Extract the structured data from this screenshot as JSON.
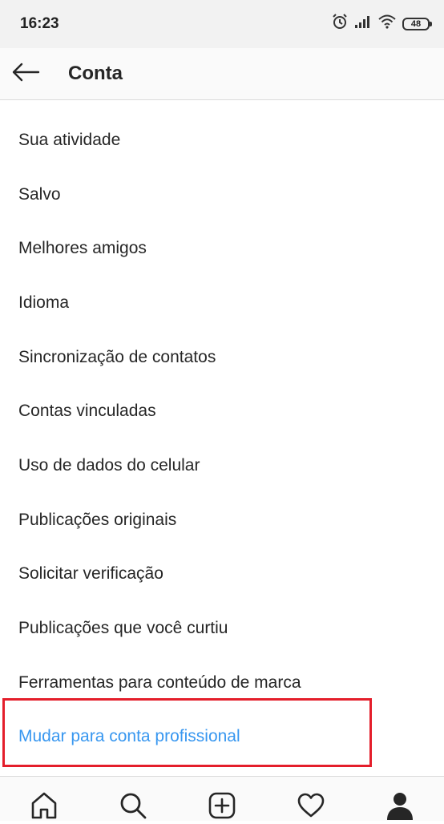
{
  "status_bar": {
    "time": "16:23",
    "battery": "48",
    "icons": [
      "alarm-icon",
      "signal-icon",
      "wifi-icon",
      "battery-icon"
    ]
  },
  "header": {
    "title": "Conta",
    "back_icon": "back-arrow-icon"
  },
  "menu": {
    "items": [
      {
        "label": "Sua atividade"
      },
      {
        "label": "Salvo"
      },
      {
        "label": "Melhores amigos"
      },
      {
        "label": "Idioma"
      },
      {
        "label": "Sincronização de contatos"
      },
      {
        "label": "Contas vinculadas"
      },
      {
        "label": "Uso de dados do celular"
      },
      {
        "label": "Publicações originais"
      },
      {
        "label": "Solicitar verificação"
      },
      {
        "label": "Publicações que você curtiu"
      },
      {
        "label": "Ferramentas para conteúdo de marca"
      },
      {
        "label": "Mudar para conta profissional"
      }
    ]
  },
  "bottom_nav": {
    "icons": [
      "home-icon",
      "search-icon",
      "new-post-icon",
      "activity-heart-icon",
      "profile-icon"
    ]
  },
  "colors": {
    "link_blue": "#3897f0",
    "highlight_red": "#e41e2b",
    "text": "#262626"
  }
}
